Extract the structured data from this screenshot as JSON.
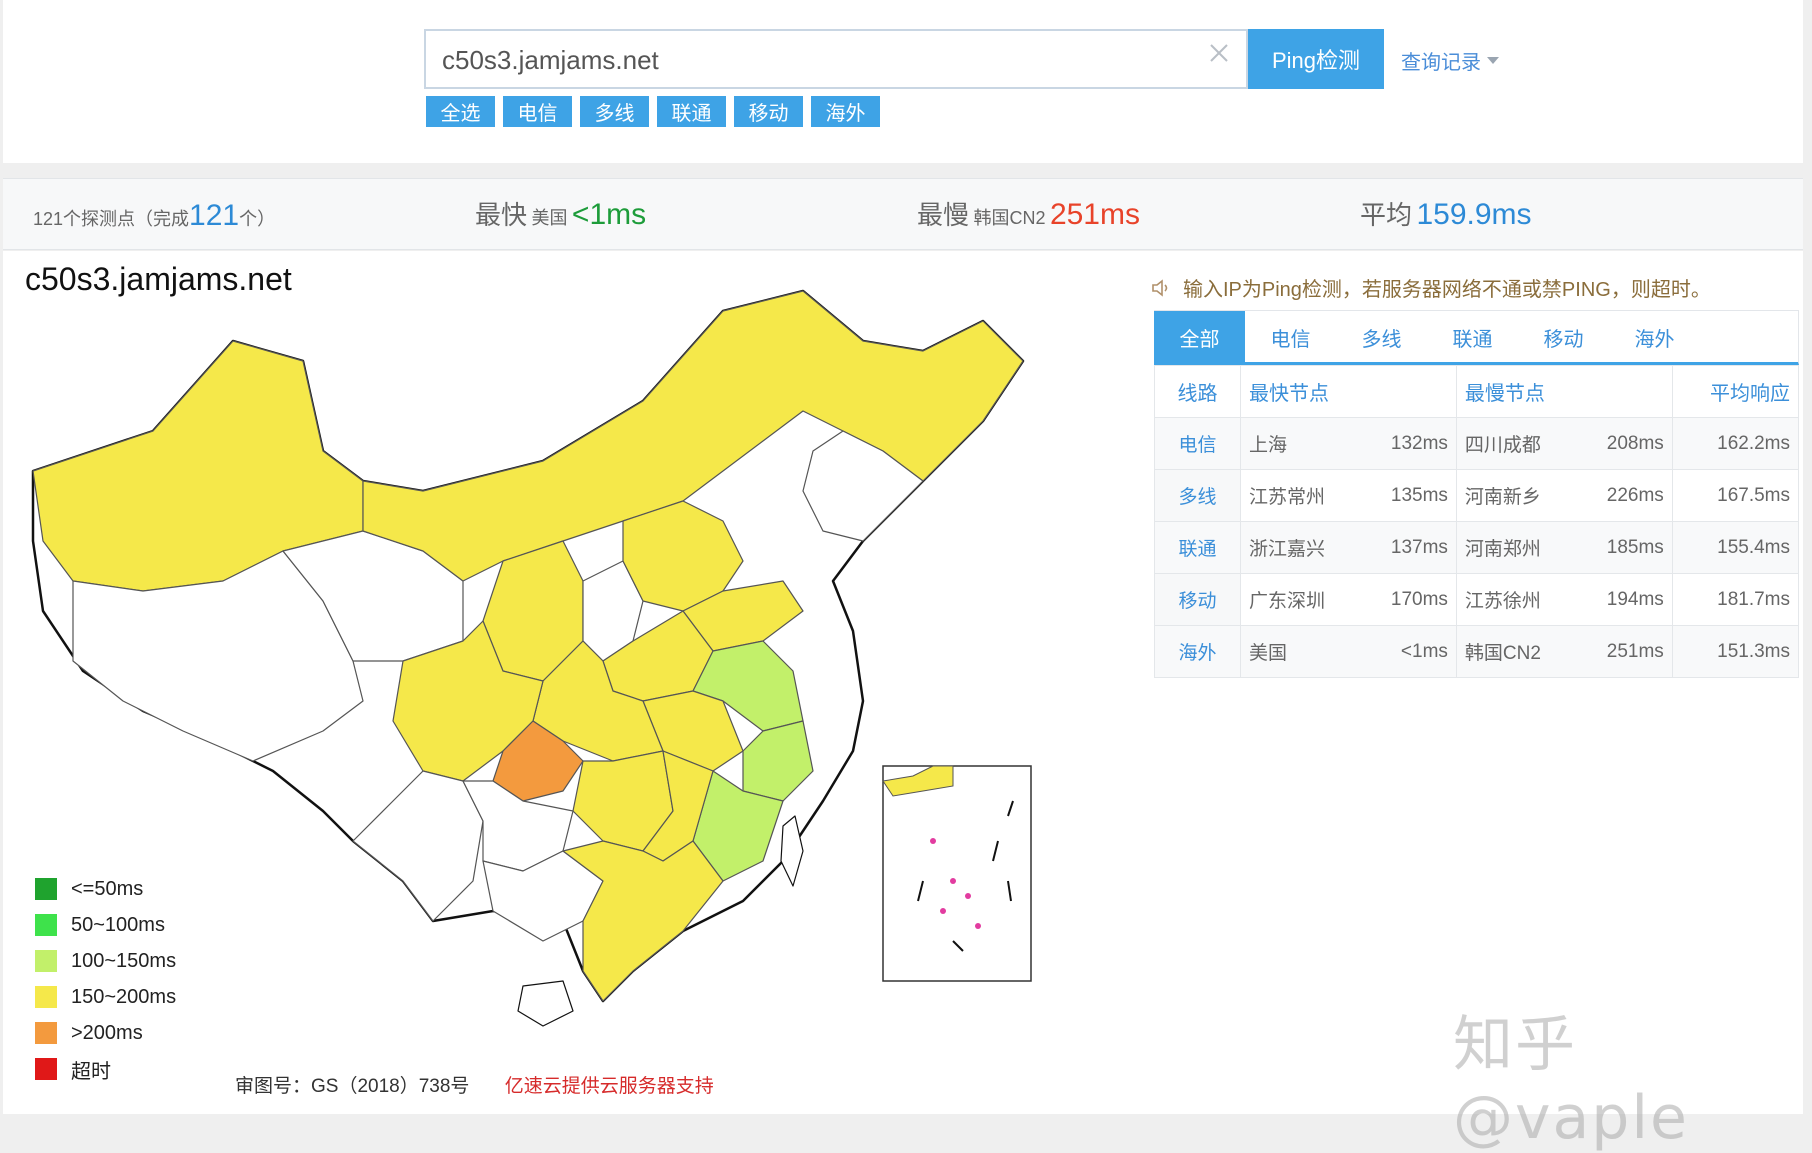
{
  "search": {
    "value": "c50s3.jamjams.net",
    "ping_label": "Ping检测",
    "history_label": "查询记录",
    "tags": [
      "全选",
      "电信",
      "多线",
      "联通",
      "移动",
      "海外"
    ]
  },
  "stats": {
    "probe_prefix": "121个探测点（完成",
    "probe_done": "121",
    "probe_suffix": "个）",
    "fastest_label": "最快",
    "fastest_node": "美国",
    "fastest_value": "<1ms",
    "slowest_label": "最慢",
    "slowest_node": "韩国CN2",
    "slowest_value": "251ms",
    "avg_label": "平均",
    "avg_value": "159.9ms"
  },
  "map": {
    "title": "c50s3.jamjams.net",
    "legend": [
      {
        "label": "<=50ms",
        "color": "#1fa32e"
      },
      {
        "label": "50~100ms",
        "color": "#3ee24b"
      },
      {
        "label": "100~150ms",
        "color": "#c2f06a"
      },
      {
        "label": "150~200ms",
        "color": "#f5e84a"
      },
      {
        "label": ">200ms",
        "color": "#f39a3e"
      },
      {
        "label": "超时",
        "color": "#e01818"
      }
    ],
    "approval": "审图号：GS（2018）738号",
    "support": "亿速云提供云服务器支持"
  },
  "notice": "输入IP为Ping检测，若服务器网络不通或禁PING，则超时。",
  "tabs": [
    "全部",
    "电信",
    "多线",
    "联通",
    "移动",
    "海外"
  ],
  "table": {
    "headers": [
      "线路",
      "最快节点",
      "最慢节点",
      "平均响应"
    ],
    "rows": [
      {
        "line": "电信",
        "fast_node": "上海",
        "fast_ms": "132ms",
        "slow_node": "四川成都",
        "slow_ms": "208ms",
        "avg": "162.2ms"
      },
      {
        "line": "多线",
        "fast_node": "江苏常州",
        "fast_ms": "135ms",
        "slow_node": "河南新乡",
        "slow_ms": "226ms",
        "avg": "167.5ms"
      },
      {
        "line": "联通",
        "fast_node": "浙江嘉兴",
        "fast_ms": "137ms",
        "slow_node": "河南郑州",
        "slow_ms": "185ms",
        "avg": "155.4ms"
      },
      {
        "line": "移动",
        "fast_node": "广东深圳",
        "fast_ms": "170ms",
        "slow_node": "江苏徐州",
        "slow_ms": "194ms",
        "avg": "181.7ms"
      },
      {
        "line": "海外",
        "fast_node": "美国",
        "fast_ms": "<1ms",
        "slow_node": "韩国CN2",
        "slow_ms": "251ms",
        "avg": "151.3ms"
      }
    ]
  },
  "watermark": "知乎 @vaple"
}
